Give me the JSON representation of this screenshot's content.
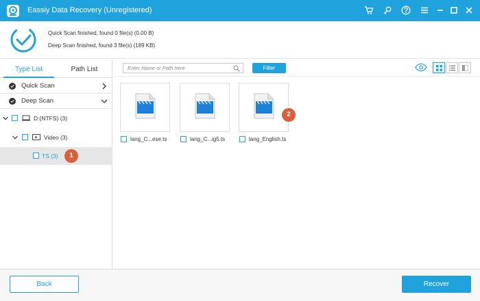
{
  "window": {
    "title": "Eassiy Data Recovery (Unregistered)",
    "accent_color": "#20a3dc",
    "badge_color": "#d9603b",
    "title_buttons": [
      "cart-icon",
      "key-icon",
      "help-icon",
      "menu-icon",
      "minimize-icon",
      "maximize-icon",
      "close-icon"
    ]
  },
  "status": {
    "quick_scan": "Quick Scan finished, found 0 file(s) (0.00  B)",
    "deep_scan": "Deep Scan finished, found 3 file(s) (189 KB)"
  },
  "sidebar": {
    "tabs": [
      {
        "label": "Type List",
        "active": true
      },
      {
        "label": "Path List",
        "active": false
      }
    ],
    "scan_sections": [
      {
        "label": "Quick Scan",
        "expanded": false
      },
      {
        "label": "Deep Scan",
        "expanded": true
      }
    ],
    "tree": [
      {
        "label": "D:(NTFS) (3)",
        "icon": "drive-icon",
        "expanded": true,
        "checked": false
      },
      {
        "label": "Video (3)",
        "icon": "video-icon",
        "expanded": true,
        "checked": false
      },
      {
        "label": "TS (3)",
        "selected": true,
        "checked": false
      }
    ],
    "step_badge": "1"
  },
  "toolbar": {
    "search_placeholder": "Enter Name or Path here",
    "filter_label": "Filter",
    "views": [
      "grid-view-icon",
      "list-view-icon",
      "detail-view-icon"
    ],
    "active_view": "grid-view-icon"
  },
  "files": [
    {
      "name": "lang_C...ese.ts",
      "checked": false
    },
    {
      "name": "lang_C...ig5.ts",
      "checked": false
    },
    {
      "name": "lang_English.ts",
      "checked": false
    }
  ],
  "content_badge": "2",
  "footer": {
    "back_label": "Back",
    "recover_label": "Recover"
  }
}
